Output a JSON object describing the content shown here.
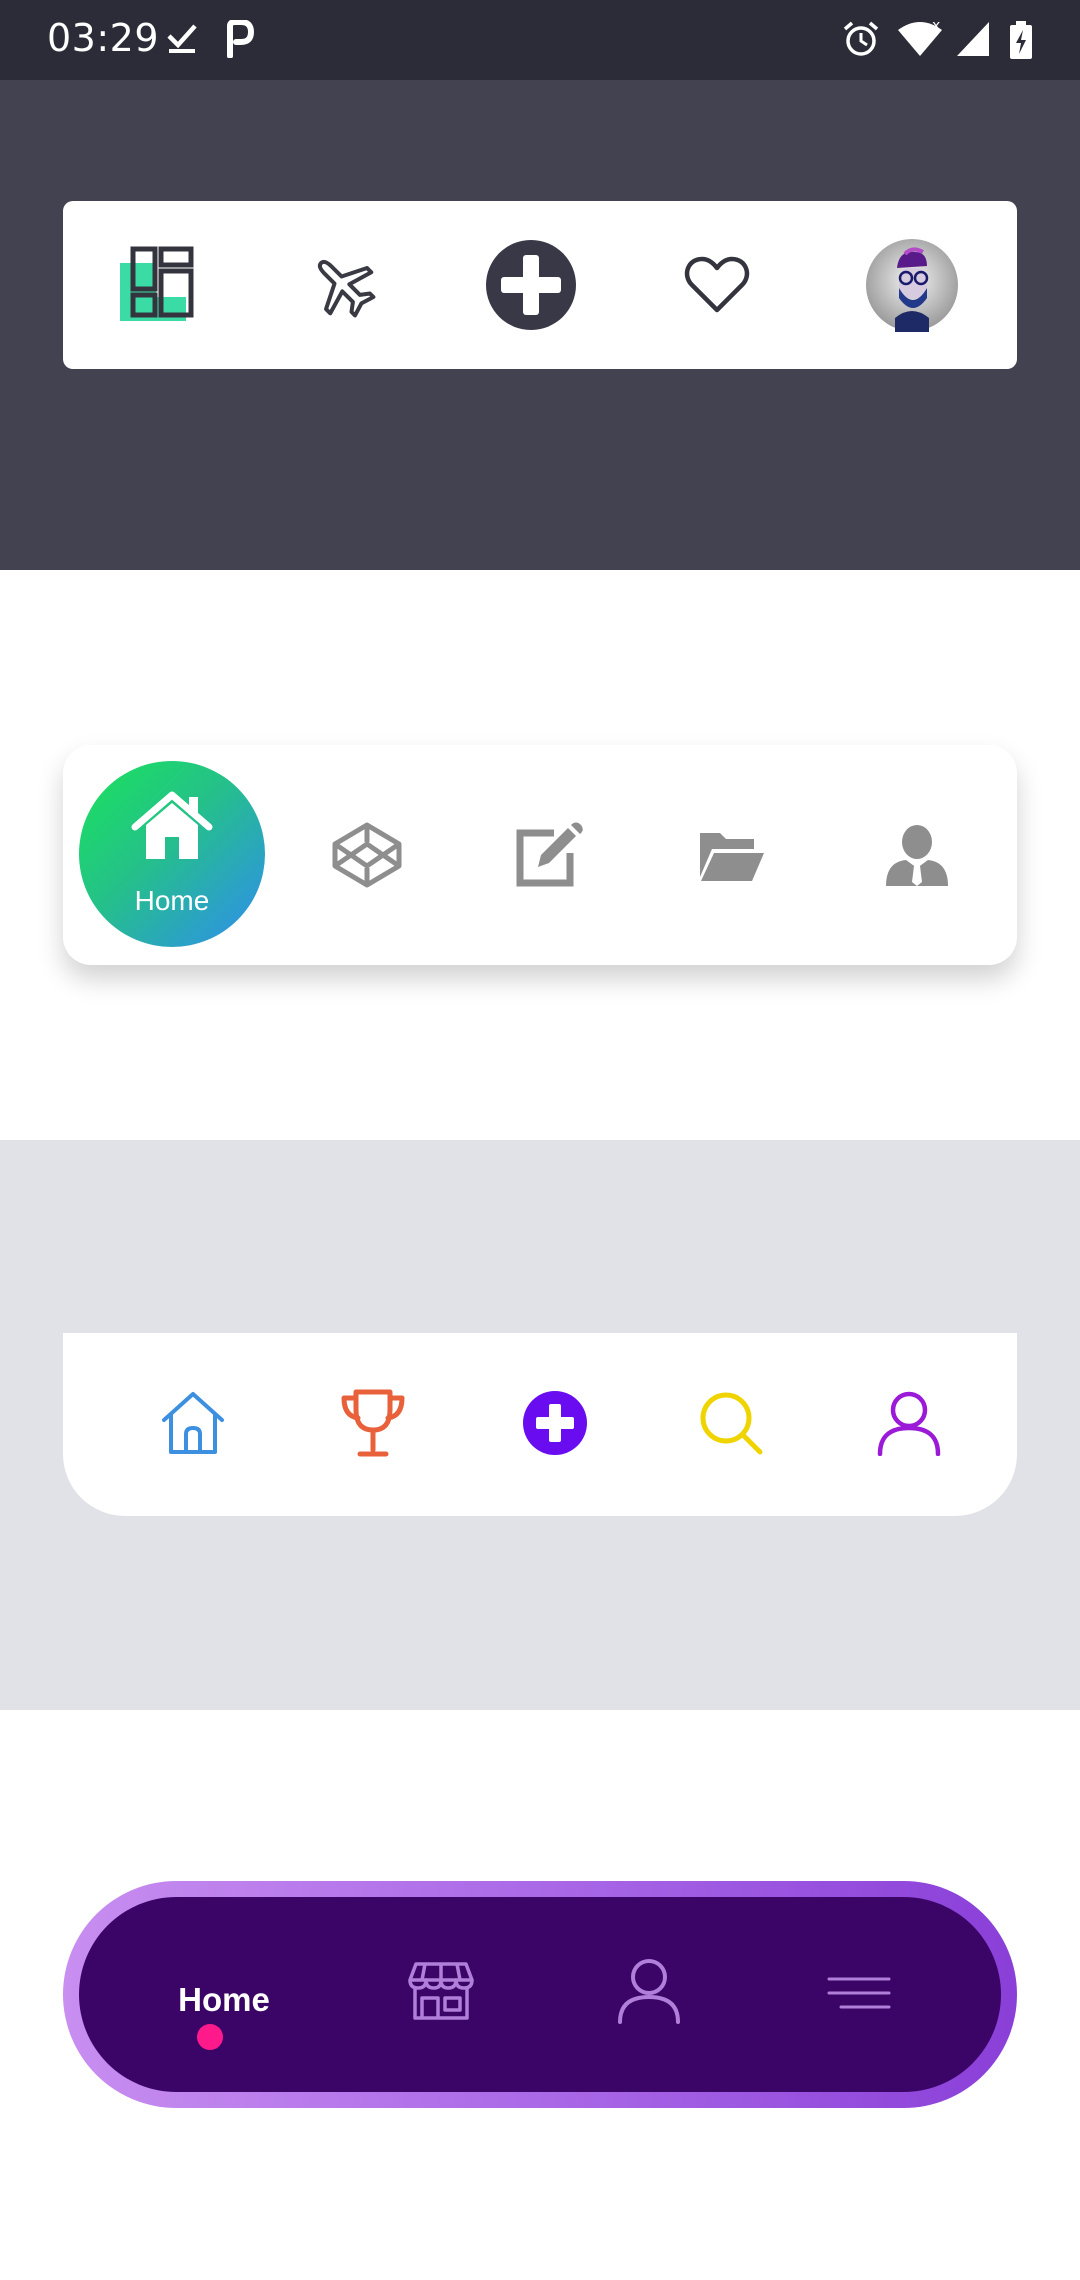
{
  "status_bar": {
    "time": "03:29",
    "left_icons": [
      "check-icon",
      "p-notification-icon"
    ],
    "right_icons": [
      "alarm-icon",
      "wifi-icon",
      "signal-icon",
      "battery-charging-icon"
    ],
    "background": "#2c2c38"
  },
  "nav_bar_1": {
    "background": "#434250",
    "items": [
      {
        "icon": "dashboard-icon",
        "accent": "#3bdba5",
        "active": true
      },
      {
        "icon": "airplane-icon"
      },
      {
        "icon": "add-circle-icon",
        "accent": "#383846"
      },
      {
        "icon": "heart-icon"
      },
      {
        "icon": "avatar"
      }
    ]
  },
  "nav_bar_2": {
    "items": [
      {
        "icon": "home-icon",
        "label": "Home",
        "active": true
      },
      {
        "icon": "codepen-cube-icon"
      },
      {
        "icon": "edit-icon"
      },
      {
        "icon": "folder-open-icon"
      },
      {
        "icon": "user-tie-icon"
      }
    ],
    "gradient": [
      "#19e35a",
      "#2f8cf0"
    ]
  },
  "nav_bar_3": {
    "background": "#e1e2e7",
    "items": [
      {
        "icon": "home-outline-icon",
        "color": "#3d8fe0"
      },
      {
        "icon": "trophy-icon",
        "color": "#e8613a"
      },
      {
        "icon": "add-circle-icon",
        "color": "#6a0cf0"
      },
      {
        "icon": "search-icon",
        "color": "#f0d400"
      },
      {
        "icon": "user-outline-icon",
        "color": "#9a1ad8"
      }
    ]
  },
  "nav_bar_4": {
    "items": [
      {
        "label": "Home",
        "active": true
      },
      {
        "icon": "store-icon"
      },
      {
        "icon": "user-outline-icon"
      },
      {
        "icon": "menu-lines-icon"
      }
    ],
    "active_dot_color": "#ff1a8c",
    "background": "#3b0567"
  }
}
